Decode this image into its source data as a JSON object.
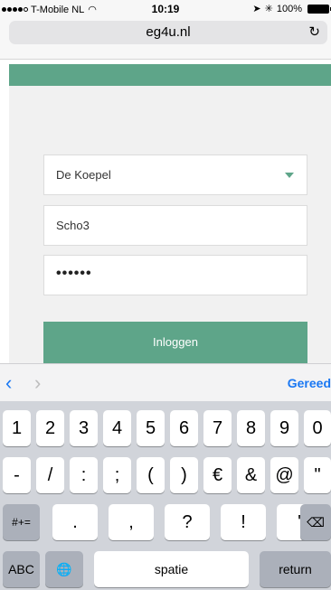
{
  "status_bar": {
    "carrier": "T-Mobile NL",
    "time": "10:19",
    "battery_percent": "100%"
  },
  "browser": {
    "url": "eg4u.nl",
    "reload_icon": "reload-icon"
  },
  "login_form": {
    "school_select": "De Koepel",
    "username": "Scho3",
    "password_masked": "••••••",
    "login_button": "Inloggen"
  },
  "keyboard_toolbar": {
    "prev_icon": "chevron-left-icon",
    "next_icon": "chevron-right-icon",
    "done_label": "Gereed"
  },
  "keyboard": {
    "row1": [
      "1",
      "2",
      "3",
      "4",
      "5",
      "6",
      "7",
      "8",
      "9",
      "0"
    ],
    "row2": [
      "-",
      "/",
      ":",
      ";",
      "(",
      ")",
      "€",
      "&",
      "@",
      "\""
    ],
    "row3": {
      "shift": "#+=",
      "keys": [
        ".",
        ",",
        "?",
        "!",
        "'"
      ]
    },
    "row4": {
      "abc": "ABC",
      "space": "spatie",
      "return": "return"
    }
  },
  "colors": {
    "accent": "#5ea589",
    "ios_blue": "#1a78f3",
    "keyboard_bg": "#d1d4da"
  }
}
